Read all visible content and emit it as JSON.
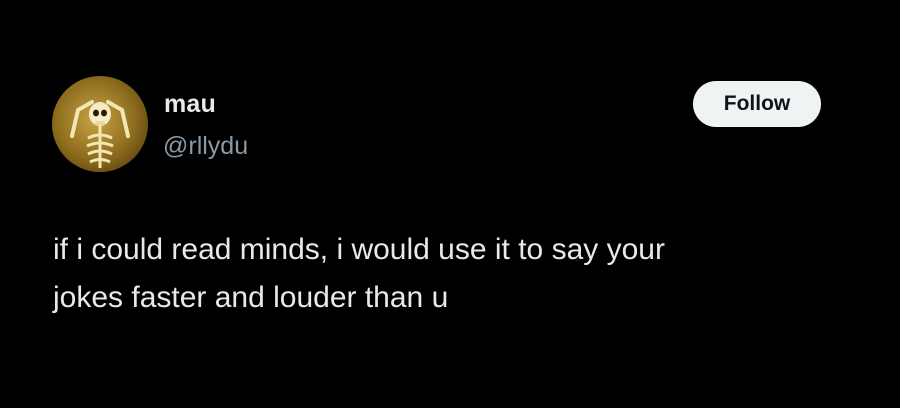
{
  "tweet": {
    "author": {
      "display_name": "mau",
      "handle": "@rllydu",
      "avatar_icon": "skeleton-avatar-icon"
    },
    "follow_label": "Follow",
    "text_lines": [
      "if i could read minds, i would use it to say your",
      "jokes faster and louder than u"
    ]
  },
  "colors": {
    "background": "#000000",
    "primary_text": "#e7e9ea",
    "secondary_text": "#8b98a5",
    "button_bg": "#eff3f4",
    "button_text": "#0f1419",
    "avatar_gold": "#c9a445"
  }
}
